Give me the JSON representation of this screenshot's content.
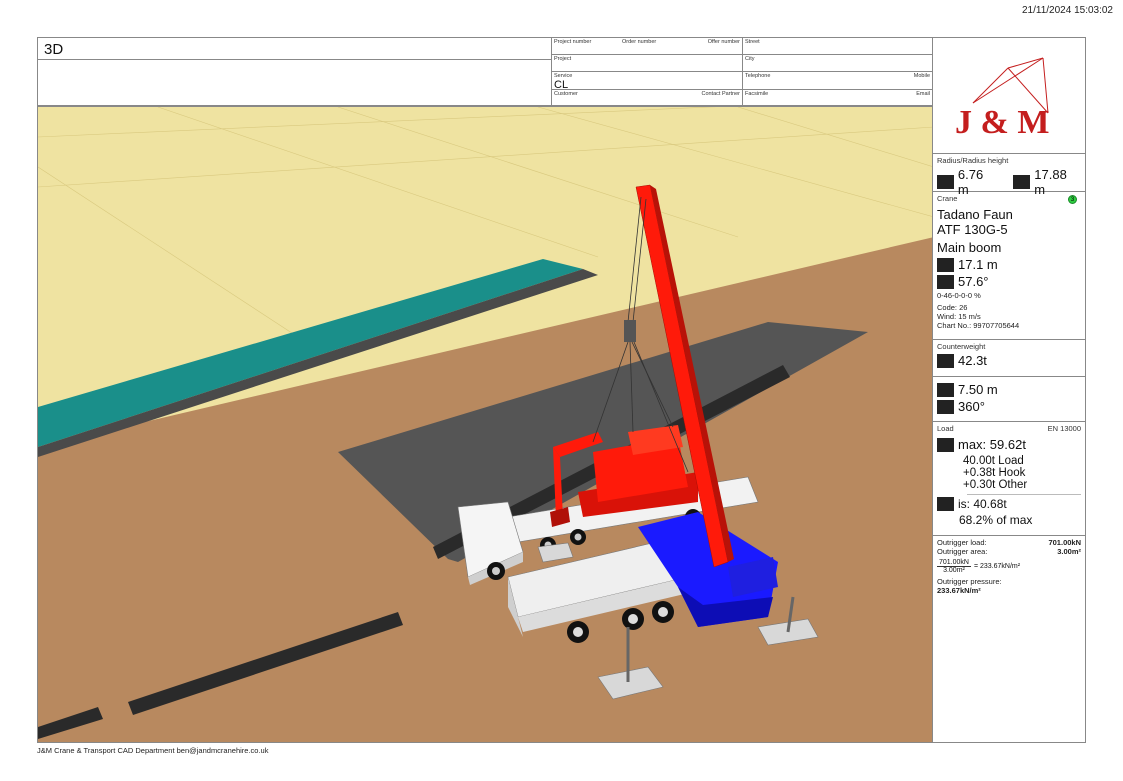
{
  "timestamp": "21/11/2024 15:03:02",
  "header": {
    "title": "3D",
    "project_number_label": "Project number",
    "order_number_label": "Order number",
    "offer_number_label": "Offer number",
    "street_label": "Street",
    "project_label": "Project",
    "city_label": "City",
    "service_label": "Service",
    "service_value": "CL",
    "telephone_label": "Telephone",
    "mobile_label": "Mobile",
    "customer_label": "Customer",
    "contact_partner_label": "Contact Partner",
    "facsimile_label": "Facsimile",
    "email_label": "Email"
  },
  "logo": {
    "text": "J & M"
  },
  "radius": {
    "label": "Radius/Radius height",
    "radius_value": "6.76 m",
    "height_value": "17.88 m"
  },
  "crane": {
    "label": "Crane",
    "badge": "3",
    "make": "Tadano Faun",
    "model": "ATF 130G-5",
    "boom_type": "Main boom",
    "boom_length": "17.1 m",
    "boom_angle": "57.6°",
    "extension": "0-46-0-0-0 %",
    "code": "Code: 26",
    "wind": "Wind: 15 m/s",
    "chart_no": "Chart No.: 99707705644"
  },
  "counterweight": {
    "label": "Counterweight",
    "value": "42.3t"
  },
  "outrigger_span": {
    "span": "7.50 m",
    "slew": "360°"
  },
  "load": {
    "label": "Load",
    "standard": "EN 13000",
    "max": "max: 59.62t",
    "line1": "40.00t Load",
    "line2": "+0.38t Hook",
    "line3": "+0.30t Other",
    "is": "is: 40.68t",
    "percent": "68.2% of max"
  },
  "outrigger": {
    "load_label": "Outrigger load:",
    "load_value": "701.00kN",
    "area_label": "Outrigger area:",
    "area_value": "3.00m²",
    "fraction_num": "701.00kN",
    "fraction_den": "3.00m²",
    "fraction_result": "= 233.67kN/m²",
    "pressure_label": "Outrigger pressure:",
    "pressure_value": "233.67kN/m²"
  },
  "footer": "J&M Crane & Transport CAD Department ben@jandmcranehire.co.uk",
  "colors": {
    "sky": "#efe3a1",
    "ground": "#b8895f",
    "water": "#1a8f8a",
    "crane_red": "#ff1a0a",
    "crane_blue": "#1a1aff"
  }
}
